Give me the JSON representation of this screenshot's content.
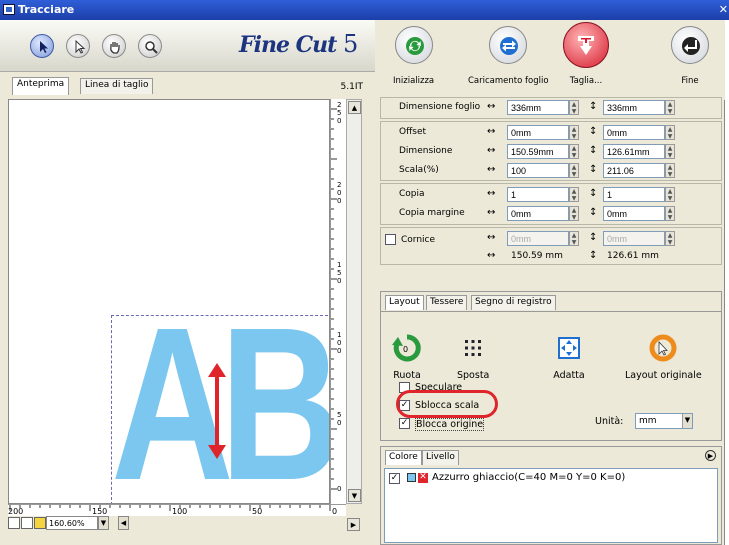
{
  "window": {
    "title": "Tracciare"
  },
  "logo": {
    "text": "Fine Cut",
    "version": "5"
  },
  "toolbar": {
    "buttons": [
      {
        "label": "Inizializza"
      },
      {
        "label": "Caricamento foglio"
      },
      {
        "label": "Taglia..."
      },
      {
        "label": "Fine"
      }
    ]
  },
  "preview": {
    "tabs": [
      {
        "label": "Anteprima"
      },
      {
        "label": "Linea di taglio"
      }
    ],
    "version": "5.1IT",
    "sample_text": "ABC",
    "ruler_v_labels": [
      "250",
      "200",
      "150",
      "100",
      "50",
      "0"
    ],
    "ruler_h_labels": [
      "200",
      "150",
      "100",
      "50",
      "0"
    ],
    "zoom": "160.60%"
  },
  "params": {
    "sheet": {
      "label": "Dimensione foglio",
      "h": "336mm",
      "v": "336mm"
    },
    "offset": {
      "label": "Offset",
      "h": "0mm",
      "v": "0mm"
    },
    "size": {
      "label": "Dimensione",
      "h": "150.59mm",
      "v": "126.61mm"
    },
    "scale": {
      "label": "Scala(%)",
      "h": "100",
      "v": "211.06"
    },
    "copy": {
      "label": "Copia",
      "h": "1",
      "v": "1"
    },
    "copy_margin": {
      "label": "Copia margine",
      "h": "0mm",
      "v": "0mm"
    },
    "frame": {
      "label": "Cornice",
      "h": "0mm",
      "v": "0mm",
      "checked": false
    },
    "total": {
      "h": "150.59 mm",
      "v": "126.61 mm"
    }
  },
  "layout_panel": {
    "tabs": [
      {
        "label": "Layout"
      },
      {
        "label": "Tessere"
      },
      {
        "label": "Segno di registro"
      }
    ],
    "buttons": [
      {
        "label": "Ruota",
        "icon": "rotate-icon"
      },
      {
        "label": "Sposta",
        "icon": "move-icon"
      },
      {
        "label": "Adatta",
        "icon": "fit-icon"
      },
      {
        "label": "Layout originale",
        "icon": "reset-layout-icon"
      }
    ],
    "options": [
      {
        "label": "Speculare",
        "checked": false
      },
      {
        "label": "Sblocca scala",
        "checked": true
      },
      {
        "label": "Blocca origine",
        "checked": true
      }
    ],
    "unit_label": "Unità:",
    "unit_value": "mm"
  },
  "color_panel": {
    "tabs": [
      {
        "label": "Colore"
      },
      {
        "label": "Livello"
      }
    ],
    "items": [
      {
        "label": "Azzurro ghiaccio(C=40 M=0 Y=0 K=0)",
        "color": "#7cc7ef"
      }
    ]
  },
  "colors": {
    "accent": "#1d3580",
    "highlight": "#e0242c",
    "letters": "#7cc7ef"
  }
}
